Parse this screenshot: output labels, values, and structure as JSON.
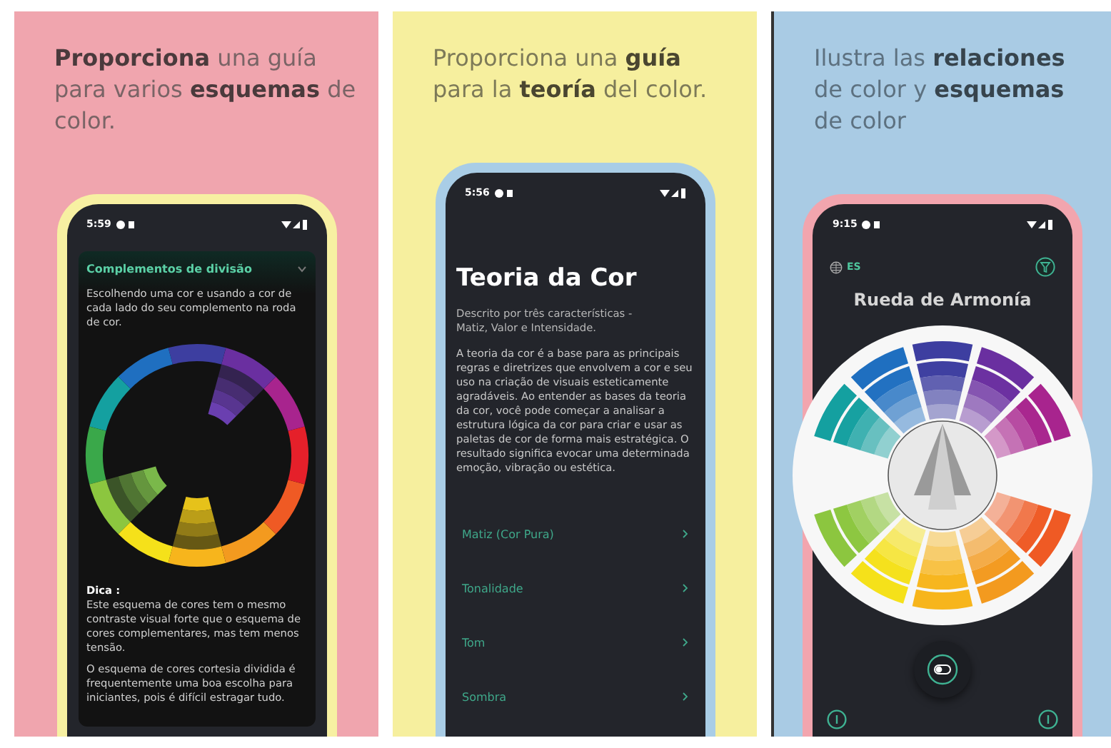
{
  "panels": [
    {
      "kind": "split-complements",
      "headline": "**Proporciona** una guía para varios **esquemas** de color.",
      "status_time": "5:59",
      "card": {
        "title": "Complementos de divisão",
        "expanded": true,
        "description": "Escolhendo uma cor e usando a cor de cada lado do seu complemento na roda de cor.",
        "tip_label": "Dica :",
        "tip_paragraphs": [
          "Este esquema de cores tem o mesmo contraste visual forte que o esquema de cores complementares, mas tem menos tensão.",
          "O esquema de cores cortesia dividida é frequentemente uma boa escolha para iniciantes, pois é difícil estragar tudo."
        ]
      }
    },
    {
      "kind": "theory",
      "headline": "Proporciona una **guía** para la **teoría** del color.",
      "status_time": "5:56",
      "title": "Teoria da Cor",
      "subtitle": "Descrito por três características -\nMatiz, Valor e Intensidade.",
      "body": "A teoria da cor é a base para as principais regras e diretrizes que envolvem a cor e seu uso na criação de visuais esteticamente agradáveis. Ao entender as bases da teoria da cor, você pode começar a analisar a estrutura lógica da cor para criar e usar as paletas de cor de forma mais estratégica. O resultado significa evocar uma determinada emoção, vibração ou estética.",
      "topics": [
        "Matiz (Cor Pura)",
        "Tonalidade",
        "Tom",
        "Sombra"
      ]
    },
    {
      "kind": "harmony-wheel",
      "headline": "Ilustra las **relaciones** de color y **esquemas** de color",
      "status_time": "9:15",
      "language": "ES",
      "title": "Rueda de Armonía"
    }
  ]
}
